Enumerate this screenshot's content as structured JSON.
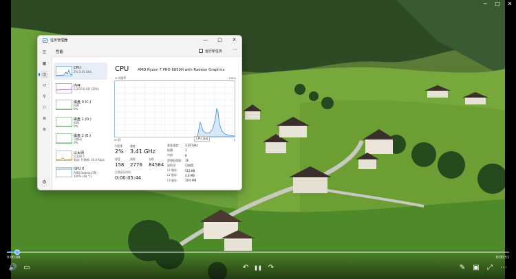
{
  "player": {
    "current_time": "0:00:09",
    "duration": "0:00:51",
    "progress_fraction": 0.02,
    "caption_buttons": [
      "−",
      "□",
      "✕"
    ],
    "controls": {
      "left": [
        {
          "icon": "volume-icon",
          "glyph": "🔊"
        },
        {
          "icon": "subtitles-icon",
          "glyph": "▭"
        }
      ],
      "center": [
        {
          "icon": "rewind-10-icon",
          "glyph": "↶"
        },
        {
          "icon": "pause-icon",
          "glyph": "❚❚"
        },
        {
          "icon": "forward-30-icon",
          "glyph": "↷"
        }
      ],
      "right": [
        {
          "icon": "edit-icon",
          "glyph": "✎"
        },
        {
          "icon": "cast-icon",
          "glyph": "▣"
        },
        {
          "icon": "fullscreen-icon",
          "glyph": "⤢"
        },
        {
          "icon": "more-icon",
          "glyph": "⋯"
        }
      ]
    }
  },
  "taskmanager": {
    "title": "任务管理器",
    "window_buttons": [
      "—",
      "□",
      "✕"
    ],
    "section_title": "性能",
    "run_new_task": "运行新任务",
    "more": "⋯",
    "nav_icons": [
      "menu-icon",
      "processes-icon",
      "performance-icon",
      "app-history-icon",
      "startup-icon",
      "users-icon",
      "details-icon",
      "services-icon"
    ],
    "devices": [
      {
        "name": "CPU",
        "sub": "2% 3.41 GHz",
        "color": "#2b7bd4",
        "active": true
      },
      {
        "name": "内存",
        "sub": "5.2/15.8 GB (33%)",
        "color": "#8b4fc4",
        "active": false
      },
      {
        "name": "磁盘 0 (C:)",
        "sub": "SSD\n0%",
        "color": "#3e9a3e",
        "active": false
      },
      {
        "name": "磁盘 1 (D:)",
        "sub": "SSD\n0%",
        "color": "#3e9a3e",
        "active": false
      },
      {
        "name": "磁盘 2 (E:)",
        "sub": "可移动\n0%",
        "color": "#3e9a3e",
        "active": false
      },
      {
        "name": "以太网",
        "sub": "以太网 5\n发送: 0 接收: 16.0 Kbps",
        "color": "#b5772a",
        "active": false
      },
      {
        "name": "GPU 0",
        "sub": "AMD Radeon(TM...\n100% (48 °C)",
        "color": "#2b7bd4",
        "active": false
      }
    ],
    "cpu": {
      "heading": "CPU",
      "model": "AMD Ryzen 7 PRO 6850H with Radeon Graphics",
      "util_label": "% 利用率",
      "util_max": "100%",
      "graph_seconds": "60 秒",
      "graph_zero": "0",
      "tooltip": "CPU 活动",
      "stats": {
        "utilization_label": "利用率",
        "utilization": "2%",
        "speed_label": "速度",
        "speed": "3.41 GHz",
        "processes_label": "进程",
        "processes": "158",
        "threads_label": "线程",
        "threads": "2776",
        "handles_label": "句柄",
        "handles": "84584",
        "uptime_label": "正常运行时间",
        "uptime": "0:00:05:44"
      },
      "specs": [
        {
          "k": "基准速度:",
          "v": "3.20 GHz"
        },
        {
          "k": "插槽:",
          "v": "1"
        },
        {
          "k": "内核:",
          "v": "8"
        },
        {
          "k": "逻辑处理器:",
          "v": "16"
        },
        {
          "k": "虚拟化:",
          "v": "已启用"
        },
        {
          "k": "L1 缓存:",
          "v": "512 KB"
        },
        {
          "k": "L2 缓存:",
          "v": "4.0 MB"
        },
        {
          "k": "L3 缓存:",
          "v": "16.0 MB"
        }
      ]
    }
  }
}
